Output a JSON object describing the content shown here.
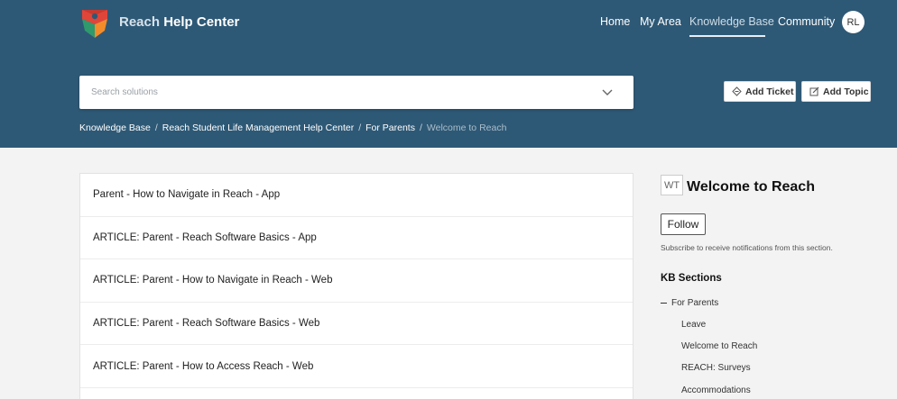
{
  "header": {
    "brand_light": "Reach",
    "brand_bold": "Help Center",
    "nav": [
      {
        "label": "Home"
      },
      {
        "label": "My Area"
      },
      {
        "label": "Knowledge Base"
      },
      {
        "label": "Community"
      }
    ],
    "avatar_initials": "RL",
    "colors": {
      "background": "#2e5976"
    }
  },
  "search": {
    "placeholder": "Search solutions"
  },
  "actions": {
    "add_ticket": "Add Ticket",
    "add_topic": "Add Topic"
  },
  "breadcrumb": {
    "items": [
      "Knowledge Base",
      "Reach Student Life Management Help Center",
      "For Parents"
    ],
    "current": "Welcome to Reach"
  },
  "articles": [
    "Parent - How to Navigate in Reach - App",
    "ARTICLE: Parent - Reach Software Basics - App",
    "ARTICLE: Parent - How to Navigate in Reach - Web",
    "ARTICLE: Parent - Reach Software Basics - Web",
    "ARTICLE: Parent - How to Access Reach - Web"
  ],
  "sidebar": {
    "badge": "WT",
    "title": "Welcome to Reach",
    "follow_label": "Follow",
    "subscribe_text": "Subscribe to receive notifications from this section.",
    "kb_sections_title": "KB Sections",
    "parent_section": "For Parents",
    "sections": [
      "Leave",
      "Welcome to Reach",
      "REACH: Surveys",
      "Accommodations"
    ]
  }
}
